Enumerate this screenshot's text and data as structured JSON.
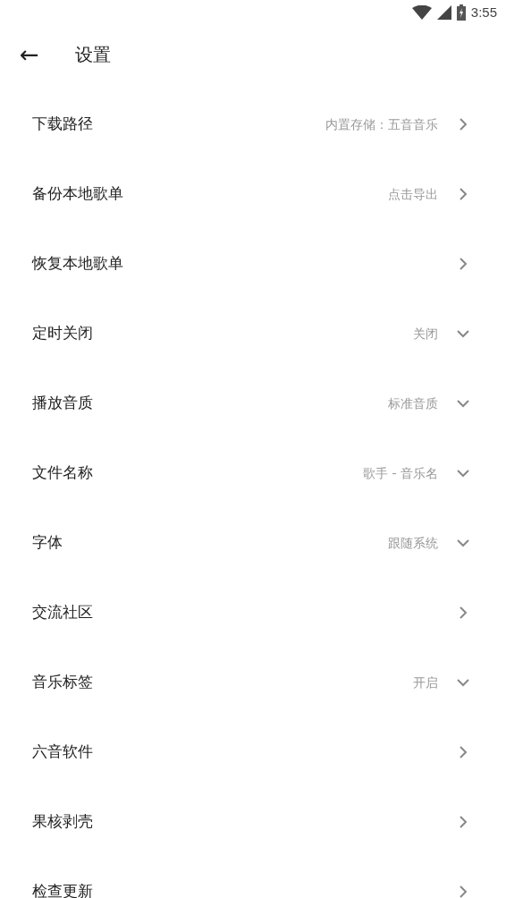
{
  "status_bar": {
    "time": "3:55"
  },
  "header": {
    "back_icon": "←",
    "title": "设置"
  },
  "settings": [
    {
      "label": "下载路径",
      "value": "内置存储：五音音乐",
      "kind": "link"
    },
    {
      "label": "备份本地歌单",
      "value": "点击导出",
      "kind": "link"
    },
    {
      "label": "恢复本地歌单",
      "kind": "link"
    },
    {
      "label": "定时关闭",
      "value": "关闭",
      "kind": "dropdown"
    },
    {
      "label": "播放音质",
      "value": "标准音质",
      "kind": "dropdown"
    },
    {
      "label": "文件名称",
      "value": "歌手 - 音乐名",
      "kind": "dropdown"
    },
    {
      "label": "字体",
      "value": "跟随系统",
      "kind": "dropdown"
    },
    {
      "label": "交流社区",
      "kind": "link"
    },
    {
      "label": "音乐标签",
      "value": "开启",
      "kind": "dropdown"
    },
    {
      "label": "六音软件",
      "kind": "link"
    },
    {
      "label": "果核剥壳",
      "kind": "link"
    },
    {
      "label": "检查更新",
      "kind": "link"
    }
  ]
}
